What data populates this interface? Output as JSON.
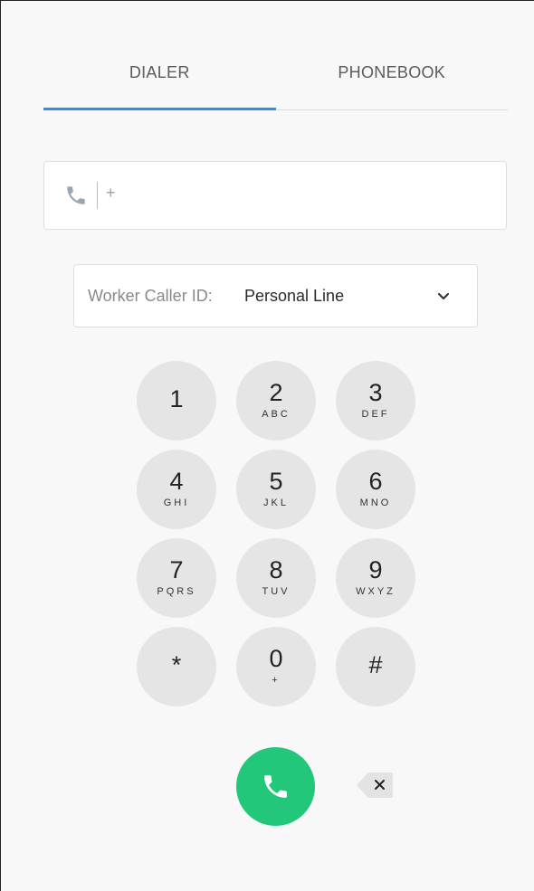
{
  "tabs": [
    {
      "label": "DIALER",
      "active": true
    },
    {
      "label": "PHONEBOOK",
      "active": false
    }
  ],
  "phone_input": {
    "prefix": "+",
    "value": "",
    "icon": "phone-icon"
  },
  "caller_id": {
    "label": "Worker Caller ID:",
    "value": "Personal Line",
    "icon": "chevron-down-icon"
  },
  "keypad": [
    {
      "digit": "1",
      "letters": ""
    },
    {
      "digit": "2",
      "letters": "ABC"
    },
    {
      "digit": "3",
      "letters": "DEF"
    },
    {
      "digit": "4",
      "letters": "GHI"
    },
    {
      "digit": "5",
      "letters": "JKL"
    },
    {
      "digit": "6",
      "letters": "MNO"
    },
    {
      "digit": "7",
      "letters": "PQRS"
    },
    {
      "digit": "8",
      "letters": "TUV"
    },
    {
      "digit": "9",
      "letters": "WXYZ"
    },
    {
      "digit": "*",
      "letters": ""
    },
    {
      "digit": "0",
      "letters": "+"
    },
    {
      "digit": "#",
      "letters": ""
    }
  ],
  "actions": {
    "call_icon": "phone-icon",
    "backspace_icon": "backspace-icon"
  },
  "colors": {
    "accent": "#2f8fe8",
    "call": "#22c77a",
    "key_bg": "#e5e5e5",
    "background": "#f8f8f8"
  }
}
